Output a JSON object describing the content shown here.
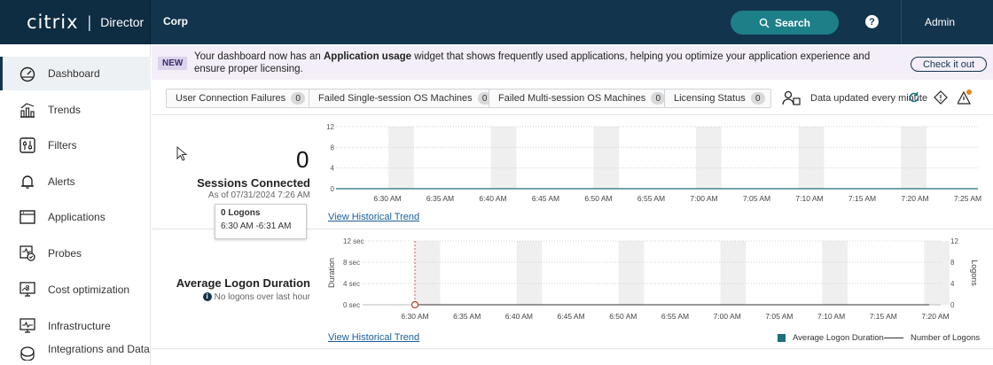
{
  "header": {
    "logo": "citrix",
    "product": "Director",
    "site": "Corp",
    "search_label": "Search",
    "help_glyph": "?",
    "user": "Admin"
  },
  "sidebar": {
    "items": [
      {
        "label": "Dashboard",
        "icon": "dashboard-icon",
        "active": true
      },
      {
        "label": "Trends",
        "icon": "trends-icon"
      },
      {
        "label": "Filters",
        "icon": "filters-icon"
      },
      {
        "label": "Alerts",
        "icon": "bell-icon"
      },
      {
        "label": "Applications",
        "icon": "applications-icon"
      },
      {
        "label": "Probes",
        "icon": "probes-icon"
      },
      {
        "label": "Cost optimization",
        "icon": "cost-icon"
      },
      {
        "label": "Infrastructure",
        "icon": "infrastructure-icon"
      },
      {
        "label": "Integrations and Data",
        "icon": "integrations-icon"
      }
    ]
  },
  "banner": {
    "badge": "NEW",
    "text_before": "Your dashboard now has an ",
    "text_bold": "Application usage",
    "text_after": " widget that shows frequently used applications, helping you optimize your application experience and ensure proper licensing.",
    "button": "Check it out"
  },
  "status": {
    "items": [
      {
        "label": "User Connection Failures",
        "count": "0"
      },
      {
        "label": "Failed Single-session OS Machines",
        "count": "0"
      },
      {
        "label": "Failed Multi-session OS Machines",
        "count": "0"
      },
      {
        "label": "Licensing Status",
        "count": "0"
      }
    ],
    "updated": "Data updated every minute"
  },
  "sessions": {
    "count": "0",
    "title": "Sessions Connected",
    "subtitle": "As of 07/31/2024 7:26 AM",
    "link": "View Historical Trend"
  },
  "logon": {
    "title": "Average Logon Duration",
    "subtitle": "No logons over last hour",
    "link": "View Historical Trend",
    "legend_bar": "Average Logon Duration",
    "legend_line": "Number of Logons"
  },
  "tooltip": {
    "title": "0 Logons",
    "range": "6:30 AM -6:31 AM"
  },
  "colors": {
    "topbar": "#13344d",
    "accent": "#1d7f88",
    "link": "#1a5e9a",
    "series": "#1d6f7b"
  },
  "chart_data": [
    {
      "type": "line",
      "name": "sessions-connected",
      "categories": [
        "6:30 AM",
        "6:35 AM",
        "6:40 AM",
        "6:45 AM",
        "6:50 AM",
        "6:55 AM",
        "7:00 AM",
        "7:05 AM",
        "7:10 AM",
        "7:15 AM",
        "7:20 AM",
        "7:25 AM"
      ],
      "y_ticks": [
        "12",
        "8",
        "4",
        "0"
      ],
      "ylim": [
        0,
        12
      ],
      "series": [
        {
          "values": [
            0,
            0,
            0,
            0,
            0,
            0,
            0,
            0,
            0,
            0,
            0,
            0
          ]
        }
      ]
    },
    {
      "type": "bar",
      "name": "average-logon-duration",
      "categories": [
        "6:30 AM",
        "6:35 AM",
        "6:40 AM",
        "6:45 AM",
        "6:50 AM",
        "6:55 AM",
        "7:00 AM",
        "7:05 AM",
        "7:10 AM",
        "7:15 AM",
        "7:20 AM"
      ],
      "y_ticks": [
        "12 sec",
        "8 sec",
        "4 sec",
        "0 sec"
      ],
      "y2_ticks": [
        "12",
        "8",
        "4",
        "0"
      ],
      "ylabel": "Duration",
      "y2label": "Logons",
      "ylim": [
        0,
        12
      ],
      "y2lim": [
        0,
        12
      ],
      "series": [
        {
          "name": "Average Logon Duration",
          "values": [
            0,
            0,
            0,
            0,
            0,
            0,
            0,
            0,
            0,
            0,
            0
          ]
        },
        {
          "name": "Number of Logons",
          "values": [
            0,
            0,
            0,
            0,
            0,
            0,
            0,
            0,
            0,
            0,
            0
          ]
        }
      ]
    }
  ]
}
